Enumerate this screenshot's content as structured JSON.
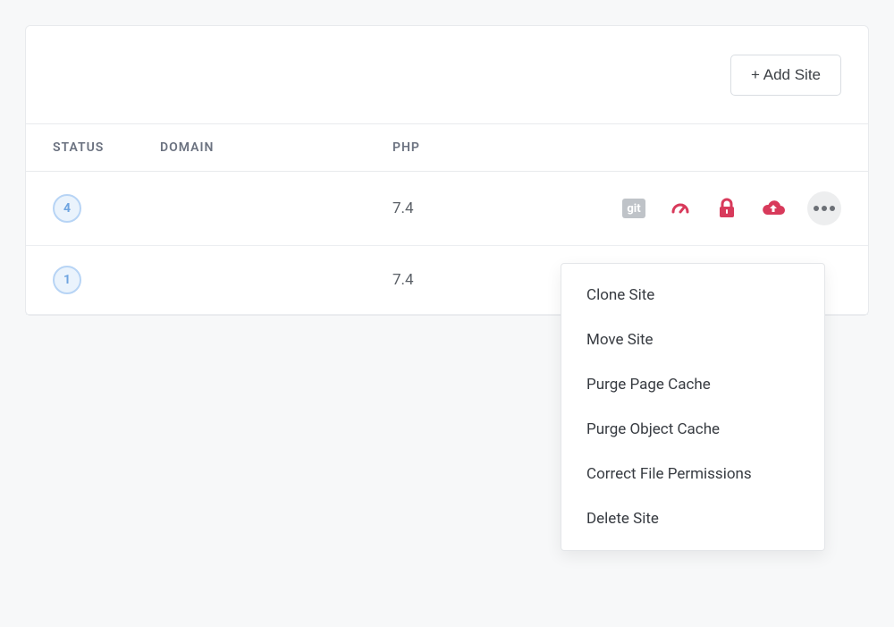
{
  "header": {
    "add_site_label": "+ Add Site"
  },
  "columns": {
    "status": "STATUS",
    "domain": "DOMAIN",
    "php": "PHP"
  },
  "rows": [
    {
      "status_count": "4",
      "domain": "",
      "php": "7.4"
    },
    {
      "status_count": "1",
      "domain": "",
      "php": "7.4"
    }
  ],
  "row_actions": {
    "git_label": "git"
  },
  "dropdown": {
    "items": [
      "Clone Site",
      "Move Site",
      "Purge Page Cache",
      "Purge Object Cache",
      "Correct File Permissions",
      "Delete Site"
    ]
  },
  "colors": {
    "accent": "#d83a5b",
    "badge_border": "#b7d4f5",
    "badge_bg": "#eaf3fc",
    "badge_text": "#6ea4e0",
    "muted": "#6b7280"
  }
}
